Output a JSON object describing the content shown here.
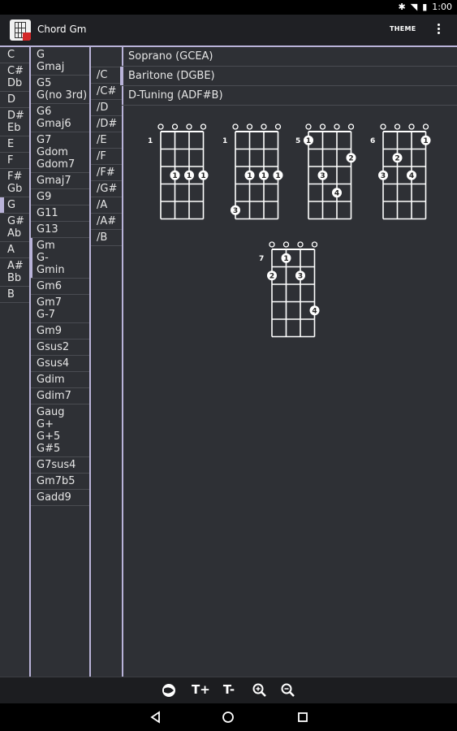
{
  "status": {
    "time": "1:00"
  },
  "app": {
    "title": "Chord Gm",
    "theme_label": "THEME"
  },
  "roots": [
    {
      "label": "C",
      "selected": false
    },
    {
      "label": "C#\nDb",
      "selected": false
    },
    {
      "label": "D",
      "selected": false
    },
    {
      "label": "D#\nEb",
      "selected": false
    },
    {
      "label": "E",
      "selected": false
    },
    {
      "label": "F",
      "selected": false
    },
    {
      "label": "F#\nGb",
      "selected": false
    },
    {
      "label": "G",
      "selected": true
    },
    {
      "label": "G#\nAb",
      "selected": false
    },
    {
      "label": "A",
      "selected": false
    },
    {
      "label": "A#\nBb",
      "selected": false
    },
    {
      "label": "B",
      "selected": false
    }
  ],
  "types": [
    {
      "label": "G\nGmaj",
      "selected": false
    },
    {
      "label": "G5\nG(no 3rd)",
      "selected": false
    },
    {
      "label": "G6\nGmaj6",
      "selected": false
    },
    {
      "label": "G7\nGdom\nGdom7",
      "selected": false
    },
    {
      "label": "Gmaj7",
      "selected": false
    },
    {
      "label": "G9",
      "selected": false
    },
    {
      "label": "G11",
      "selected": false
    },
    {
      "label": "G13",
      "selected": false
    },
    {
      "label": "Gm\nG-\nGmin",
      "selected": true
    },
    {
      "label": "Gm6",
      "selected": false
    },
    {
      "label": "Gm7\nG-7",
      "selected": false
    },
    {
      "label": "Gm9",
      "selected": false
    },
    {
      "label": "Gsus2",
      "selected": false
    },
    {
      "label": "Gsus4",
      "selected": false
    },
    {
      "label": "Gdim",
      "selected": false
    },
    {
      "label": "Gdim7",
      "selected": false
    },
    {
      "label": "Gaug\nG+\nG+5\nG#5",
      "selected": false
    },
    {
      "label": "G7sus4",
      "selected": false
    },
    {
      "label": "Gm7b5",
      "selected": false
    },
    {
      "label": "Gadd9",
      "selected": false
    }
  ],
  "bass": [
    {
      "label": ""
    },
    {
      "label": "/C"
    },
    {
      "label": "/C#"
    },
    {
      "label": "/D"
    },
    {
      "label": "/D#"
    },
    {
      "label": "/E"
    },
    {
      "label": "/F"
    },
    {
      "label": "/F#"
    },
    {
      "label": "/G#"
    },
    {
      "label": "/A"
    },
    {
      "label": "/A#"
    },
    {
      "label": "/B"
    }
  ],
  "tunings": [
    {
      "label": "Soprano (GCEA)",
      "selected": false
    },
    {
      "label": "Baritone (DGBE)",
      "selected": true
    },
    {
      "label": "D-Tuning (ADF#B)",
      "selected": false
    }
  ],
  "chords": [
    {
      "fret_label": "1",
      "dots": [
        {
          "s": 1,
          "f": 2,
          "n": "1"
        },
        {
          "s": 2,
          "f": 2,
          "n": "1"
        },
        {
          "s": 3,
          "f": 2,
          "n": "1"
        }
      ]
    },
    {
      "fret_label": "1",
      "dots": [
        {
          "s": 1,
          "f": 2,
          "n": "1"
        },
        {
          "s": 2,
          "f": 2,
          "n": "1"
        },
        {
          "s": 3,
          "f": 2,
          "n": "1"
        },
        {
          "s": 0,
          "f": 4,
          "n": "3"
        }
      ]
    },
    {
      "fret_label": "5",
      "dots": [
        {
          "s": 0,
          "f": 0,
          "n": "1"
        },
        {
          "s": 3,
          "f": 1,
          "n": "2"
        },
        {
          "s": 1,
          "f": 2,
          "n": "3"
        },
        {
          "s": 2,
          "f": 3,
          "n": "4"
        }
      ]
    },
    {
      "fret_label": "6",
      "dots": [
        {
          "s": 3,
          "f": 0,
          "n": "1"
        },
        {
          "s": 1,
          "f": 1,
          "n": "2"
        },
        {
          "s": 0,
          "f": 2,
          "n": "3"
        },
        {
          "s": 2,
          "f": 2,
          "n": "4"
        }
      ]
    },
    {
      "fret_label": "7",
      "dots": [
        {
          "s": 1,
          "f": 0,
          "n": "1"
        },
        {
          "s": 0,
          "f": 1,
          "n": "2"
        },
        {
          "s": 2,
          "f": 1,
          "n": "3"
        },
        {
          "s": 3,
          "f": 3,
          "n": "4"
        }
      ]
    }
  ],
  "toolbar": {
    "font_up": "T+",
    "font_down": "T-"
  }
}
